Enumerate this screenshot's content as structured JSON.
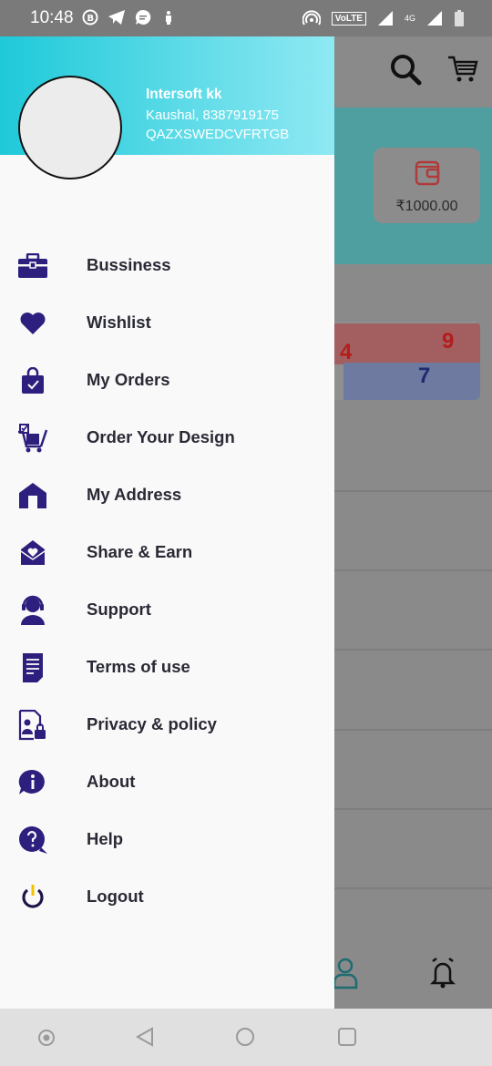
{
  "status_bar": {
    "time": "10:48",
    "volte": "VoLTE",
    "network": "4G"
  },
  "drawer": {
    "user_name": "Intersoft kk",
    "user_phone": "Kaushal, 8387919175",
    "user_code": "QAZXSWEDCVFRTGB",
    "menu": [
      {
        "label": "Bussiness",
        "icon": "briefcase-icon"
      },
      {
        "label": "Wishlist",
        "icon": "heart-icon"
      },
      {
        "label": "My Orders",
        "icon": "shopping-bag-icon"
      },
      {
        "label": "Order Your Design",
        "icon": "design-cart-icon"
      },
      {
        "label": "My Address",
        "icon": "home-icon"
      },
      {
        "label": "Share & Earn",
        "icon": "envelope-heart-icon"
      },
      {
        "label": "Support",
        "icon": "headset-icon"
      },
      {
        "label": "Terms of use",
        "icon": "document-icon"
      },
      {
        "label": "Privacy & policy",
        "icon": "privacy-lock-icon"
      },
      {
        "label": "About",
        "icon": "info-icon"
      },
      {
        "label": "Help",
        "icon": "question-icon"
      },
      {
        "label": "Logout",
        "icon": "power-icon"
      }
    ]
  },
  "background_app": {
    "wallet_amount": "₹1000.00",
    "product_numbers": [
      "4",
      "9",
      "7"
    ]
  },
  "colors": {
    "accent": "#2d1f7e",
    "header_gradient_start": "#1fc9d9",
    "header_gradient_end": "#8fe9f3"
  }
}
